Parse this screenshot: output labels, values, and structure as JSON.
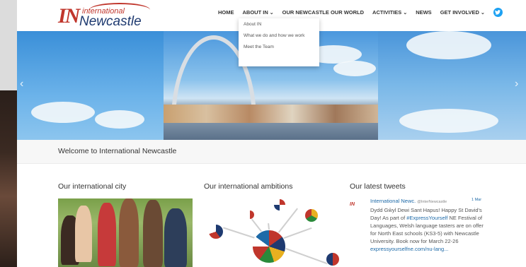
{
  "site": {
    "logo_top": "international",
    "logo_bottom": "Newcastle",
    "logo_mark": "IN"
  },
  "nav": {
    "items": [
      {
        "label": "HOME"
      },
      {
        "label": "ABOUT IN"
      },
      {
        "label": "OUR NEWCASTLE OUR WORLD"
      },
      {
        "label": "ACTIVITIES"
      },
      {
        "label": "NEWS"
      },
      {
        "label": "GET INVOLVED"
      }
    ],
    "twitter_icon": "twitter-icon"
  },
  "dropdown": {
    "items": [
      "About IN",
      "What we do and how we work",
      "Meet the Team"
    ]
  },
  "hero": {
    "prev_icon": "chevron-left-icon",
    "next_icon": "chevron-right-icon"
  },
  "welcome": {
    "text": "Welcome to International Newcastle"
  },
  "columns": {
    "city_title": "Our international city",
    "ambitions_title": "Our international ambitions",
    "tweets_title": "Our latest tweets"
  },
  "tweet": {
    "name": "International Newc.",
    "handle": "@InterNewcastle",
    "date": "1 Mar",
    "body_1": "Dydd Gŵyl Dewi Sant Hapus! Happy St David's Day! As part of ",
    "hashtag": "#ExpressYourself",
    "body_2": " NE Festival of Languages, Welsh language tasters are on offer for North East schools (KS3-5) with Newcastle University. Book now for March 22-26 ",
    "link": "expressyourselfne.com/nu-lang..."
  },
  "colors": {
    "brand_red": "#c0362c",
    "brand_blue": "#1e3a70",
    "link_blue": "#1e6aa8",
    "twitter_blue": "#1da1f2"
  }
}
